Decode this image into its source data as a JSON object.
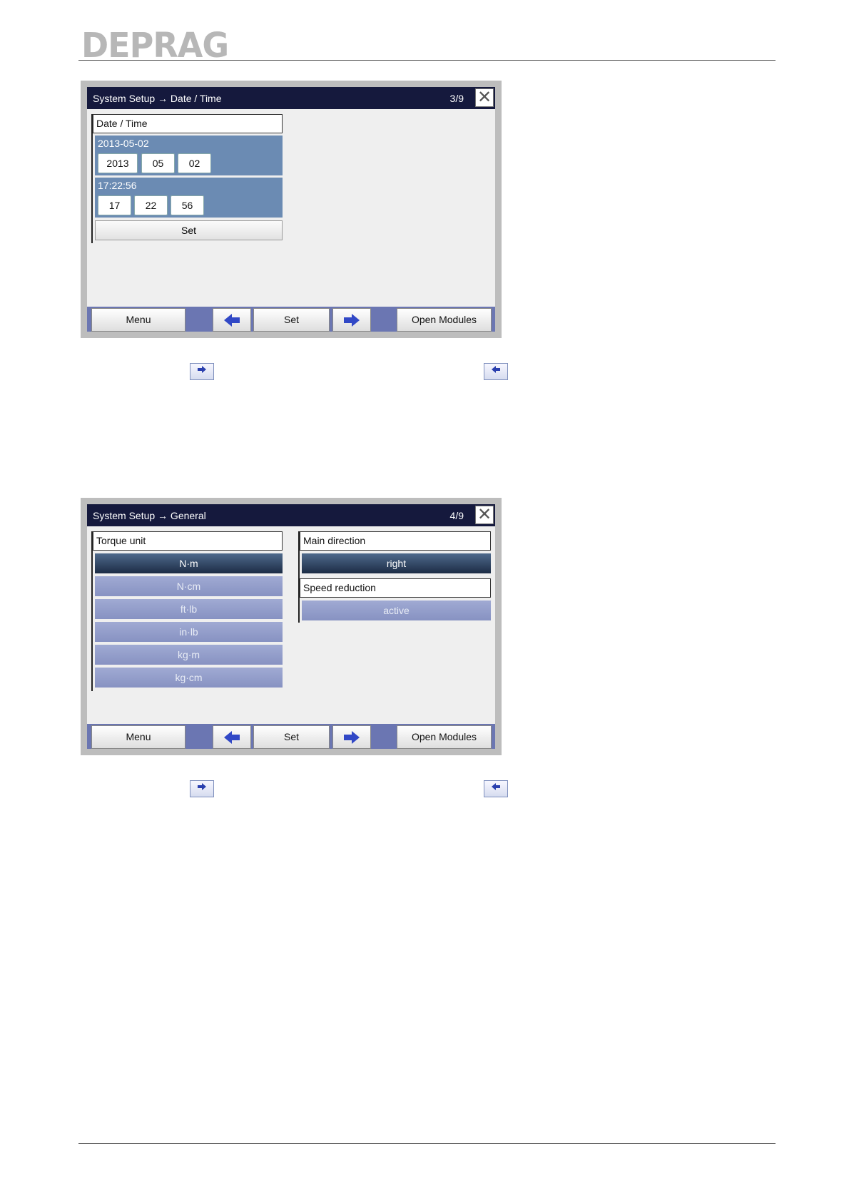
{
  "header": {
    "logo_text": "DEPRAG"
  },
  "screen1": {
    "title": "System Setup → Date / Time",
    "page": "3/9",
    "close_icon": "close-icon",
    "section_title": "Date / Time",
    "date_label": "2013-05-02",
    "date_year": "2013",
    "date_month": "05",
    "date_day": "02",
    "time_label": "17:22:56",
    "time_hour": "17",
    "time_minute": "22",
    "time_second": "56",
    "set_label": "Set"
  },
  "screen2": {
    "title": "System Setup → General",
    "page": "4/9",
    "close_icon": "close-icon",
    "torque_title": "Torque unit",
    "torque_units": [
      "N·m",
      "N·cm",
      "ft·lb",
      "in·lb",
      "kg·m",
      "kg·cm"
    ],
    "torque_selected": "N·m",
    "direction_title": "Main direction",
    "direction_value": "right",
    "speed_title": "Speed reduction",
    "speed_value": "active"
  },
  "toolbar": {
    "menu_label": "Menu",
    "set_label": "Set",
    "open_modules_label": "Open Modules",
    "prev_icon": "arrow-left-icon",
    "next_icon": "arrow-right-icon"
  },
  "colors": {
    "titlebar": "#15193d",
    "panel_blue": "#6b8bb3",
    "toolbar": "#6b76b2",
    "selected": "#1c2c45",
    "option": "#8f99c8"
  }
}
